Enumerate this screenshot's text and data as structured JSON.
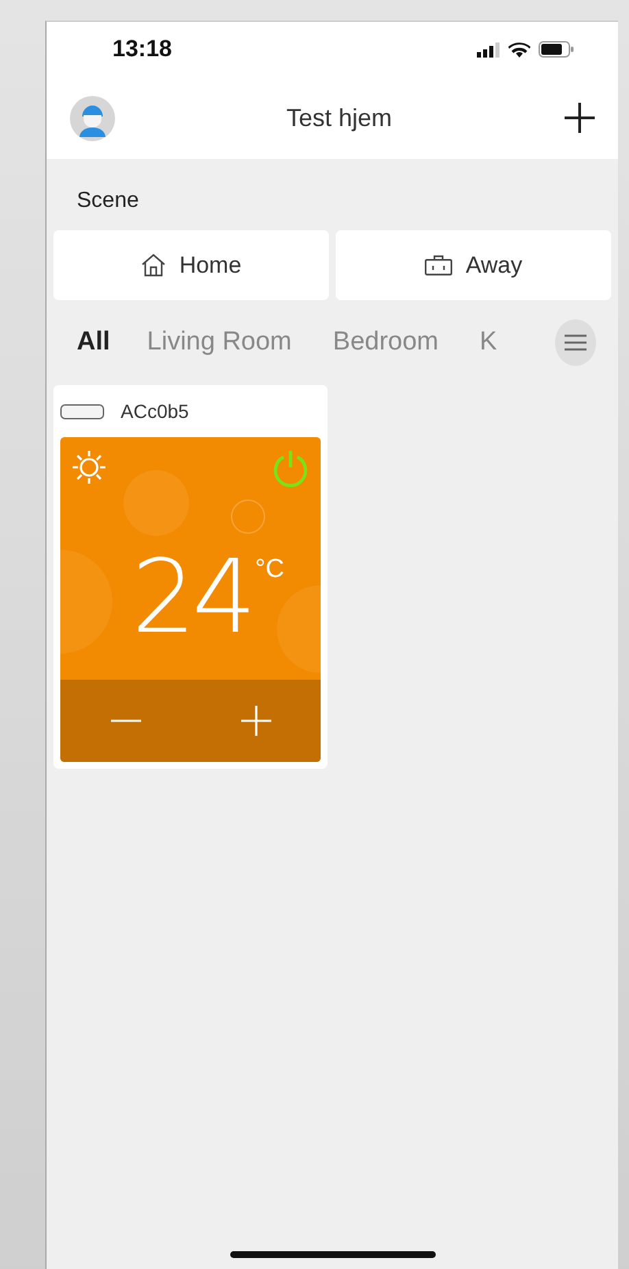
{
  "status_bar": {
    "time": "13:18"
  },
  "header": {
    "title": "Test hjem"
  },
  "scene": {
    "label": "Scene",
    "buttons": [
      {
        "label": "Home",
        "kind": "home"
      },
      {
        "label": "Away",
        "kind": "away"
      }
    ]
  },
  "room_tabs": [
    {
      "label": "All",
      "selected": true
    },
    {
      "label": "Living Room",
      "selected": false
    },
    {
      "label": "Bedroom",
      "selected": false
    },
    {
      "label": "K",
      "selected": false
    }
  ],
  "devices": [
    {
      "name": "ACc0b5",
      "temperature": "24",
      "unit": "°C",
      "power_on": true
    }
  ]
}
